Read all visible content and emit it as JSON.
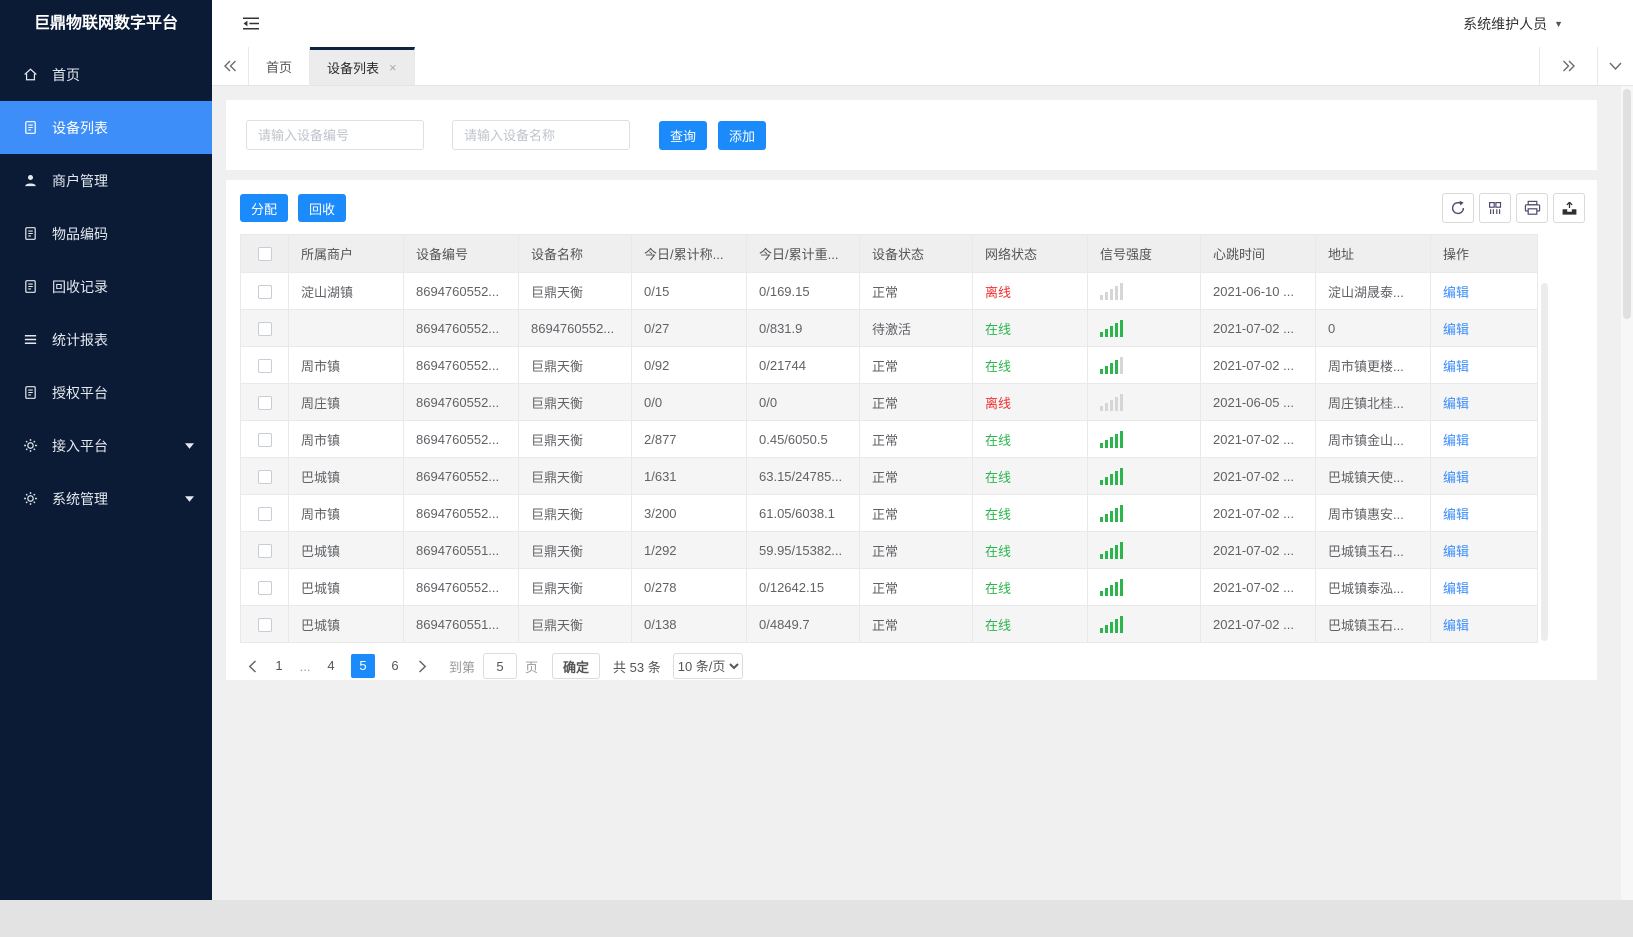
{
  "app": {
    "title": "巨鼎物联网数字平台",
    "user": "系统维护人员"
  },
  "colors": {
    "accent_blue": "#1b8bfb",
    "sidebar_bg": "#0b1b36",
    "sidebar_active_blue": "#3d8ef8",
    "online_green": "#2db54d",
    "offline_red": "#f23030",
    "link_blue": "#3d8ef8"
  },
  "sidebar": {
    "items": [
      {
        "id": "home",
        "label": "首页",
        "icon": "home-icon",
        "active": false,
        "expandable": false
      },
      {
        "id": "device-list",
        "label": "设备列表",
        "icon": "doc-icon",
        "active": true,
        "expandable": false
      },
      {
        "id": "merchant-mgmt",
        "label": "商户管理",
        "icon": "user-icon",
        "active": false,
        "expandable": false
      },
      {
        "id": "item-code",
        "label": "物品编码",
        "icon": "doc-icon",
        "active": false,
        "expandable": false
      },
      {
        "id": "recycle-records",
        "label": "回收记录",
        "icon": "doc-icon",
        "active": false,
        "expandable": false
      },
      {
        "id": "stats-report",
        "label": "统计报表",
        "icon": "list-icon",
        "active": false,
        "expandable": false
      },
      {
        "id": "auth-platform",
        "label": "授权平台",
        "icon": "doc-icon",
        "active": false,
        "expandable": false
      },
      {
        "id": "access-platform",
        "label": "接入平台",
        "icon": "gear-icon",
        "active": false,
        "expandable": true
      },
      {
        "id": "system-mgmt",
        "label": "系统管理",
        "icon": "gear-icon",
        "active": false,
        "expandable": true
      }
    ]
  },
  "tabs": {
    "items": [
      {
        "id": "home",
        "label": "首页",
        "active": false,
        "closable": false
      },
      {
        "id": "device-list",
        "label": "设备列表",
        "active": true,
        "closable": true
      }
    ]
  },
  "search": {
    "device_no_placeholder": "请输入设备编号",
    "device_name_placeholder": "请输入设备名称",
    "query_label": "查询",
    "add_label": "添加"
  },
  "toolbar": {
    "assign_label": "分配",
    "recycle_label": "回收",
    "icon_names": [
      "refresh-icon",
      "column-settings-icon",
      "printer-icon",
      "export-icon"
    ]
  },
  "table": {
    "columns": [
      "所属商户",
      "设备编号",
      "设备名称",
      "今日/累计称...",
      "今日/累计重...",
      "设备状态",
      "网络状态",
      "信号强度",
      "心跳时间",
      "地址",
      "操作"
    ],
    "edit_label": "编辑",
    "rows": [
      {
        "merchant": "淀山湖镇",
        "device_no": "8694760552...",
        "device_name": "巨鼎天衡",
        "today_count": "0/15",
        "today_weight": "0/169.15",
        "device_status": "正常",
        "net_status": "离线",
        "net_state": "offline",
        "signal": 0,
        "heartbeat": "2021-06-10 ...",
        "address": "淀山湖晟泰..."
      },
      {
        "merchant": "",
        "device_no": "8694760552...",
        "device_name": "8694760552...",
        "today_count": "0/27",
        "today_weight": "0/831.9",
        "device_status": "待激活",
        "net_status": "在线",
        "net_state": "online",
        "signal": 5,
        "heartbeat": "2021-07-02 ...",
        "address": "0"
      },
      {
        "merchant": "周市镇",
        "device_no": "8694760552...",
        "device_name": "巨鼎天衡",
        "today_count": "0/92",
        "today_weight": "0/21744",
        "device_status": "正常",
        "net_status": "在线",
        "net_state": "online",
        "signal": 4,
        "heartbeat": "2021-07-02 ...",
        "address": "周市镇更楼..."
      },
      {
        "merchant": "周庄镇",
        "device_no": "8694760552...",
        "device_name": "巨鼎天衡",
        "today_count": "0/0",
        "today_weight": "0/0",
        "device_status": "正常",
        "net_status": "离线",
        "net_state": "offline",
        "signal": 0,
        "heartbeat": "2021-06-05 ...",
        "address": "周庄镇北桂..."
      },
      {
        "merchant": "周市镇",
        "device_no": "8694760552...",
        "device_name": "巨鼎天衡",
        "today_count": "2/877",
        "today_weight": "0.45/6050.5",
        "device_status": "正常",
        "net_status": "在线",
        "net_state": "online",
        "signal": 5,
        "heartbeat": "2021-07-02 ...",
        "address": "周市镇金山..."
      },
      {
        "merchant": "巴城镇",
        "device_no": "8694760552...",
        "device_name": "巨鼎天衡",
        "today_count": "1/631",
        "today_weight": "63.15/24785...",
        "device_status": "正常",
        "net_status": "在线",
        "net_state": "online",
        "signal": 5,
        "heartbeat": "2021-07-02 ...",
        "address": "巴城镇天使..."
      },
      {
        "merchant": "周市镇",
        "device_no": "8694760552...",
        "device_name": "巨鼎天衡",
        "today_count": "3/200",
        "today_weight": "61.05/6038.1",
        "device_status": "正常",
        "net_status": "在线",
        "net_state": "online",
        "signal": 5,
        "heartbeat": "2021-07-02 ...",
        "address": "周市镇惠安..."
      },
      {
        "merchant": "巴城镇",
        "device_no": "8694760551...",
        "device_name": "巨鼎天衡",
        "today_count": "1/292",
        "today_weight": "59.95/15382...",
        "device_status": "正常",
        "net_status": "在线",
        "net_state": "online",
        "signal": 5,
        "heartbeat": "2021-07-02 ...",
        "address": "巴城镇玉石..."
      },
      {
        "merchant": "巴城镇",
        "device_no": "8694760552...",
        "device_name": "巨鼎天衡",
        "today_count": "0/278",
        "today_weight": "0/12642.15",
        "device_status": "正常",
        "net_status": "在线",
        "net_state": "online",
        "signal": 5,
        "heartbeat": "2021-07-02 ...",
        "address": "巴城镇泰泓..."
      },
      {
        "merchant": "巴城镇",
        "device_no": "8694760551...",
        "device_name": "巨鼎天衡",
        "today_count": "0/138",
        "today_weight": "0/4849.7",
        "device_status": "正常",
        "net_status": "在线",
        "net_state": "online",
        "signal": 5,
        "heartbeat": "2021-07-02 ...",
        "address": "巴城镇玉石..."
      }
    ]
  },
  "pagination": {
    "pages": [
      "1",
      "...",
      "4",
      "5",
      "6"
    ],
    "active_page": "5",
    "goto_label": "到第",
    "goto_value": "5",
    "page_unit": "页",
    "confirm_label": "确定",
    "total_label": "共 53 条",
    "page_size_label": "10 条/页"
  }
}
